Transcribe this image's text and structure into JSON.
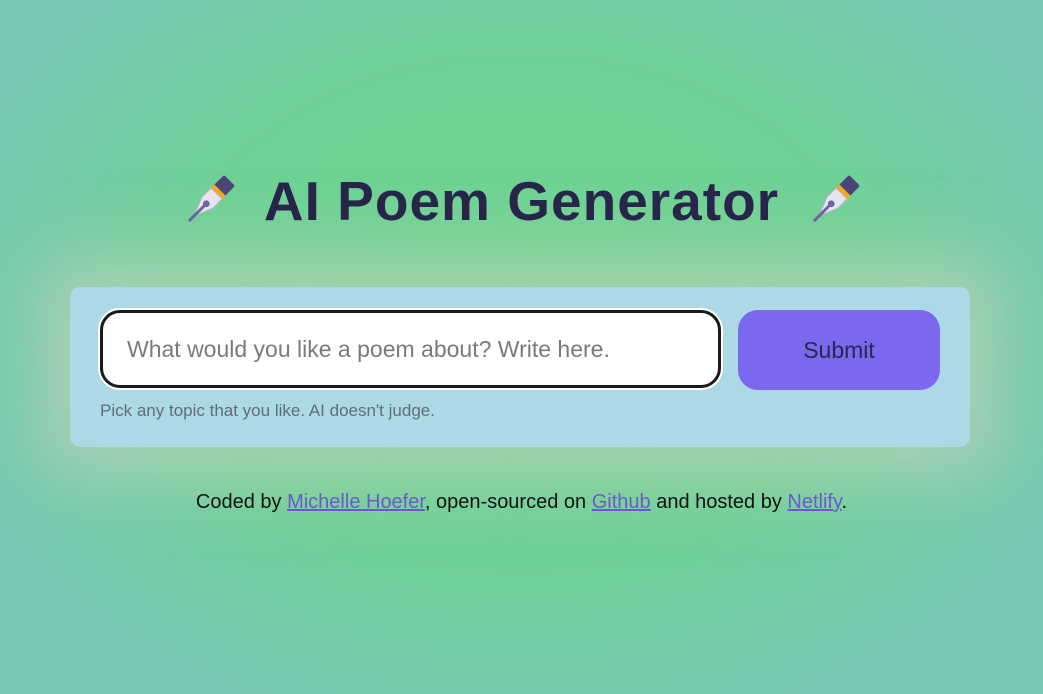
{
  "header": {
    "title": "AI Poem Generator",
    "left_icon": "fountain-pen-icon",
    "right_icon": "fountain-pen-icon"
  },
  "form": {
    "input_placeholder": "What would you like a poem about? Write here.",
    "input_value": "",
    "submit_label": "Submit",
    "hint": "Pick any topic that you like. AI doesn't judge."
  },
  "footer": {
    "prefix": "Coded by ",
    "author_link": "Michelle Hoefer",
    "middle": ", open-sourced on ",
    "github_link": "Github",
    "connector": " and hosted by ",
    "netlify_link": "Netlify",
    "suffix": "."
  },
  "colors": {
    "title": "#27264a",
    "card": "#add8e6",
    "button": "#7b68ee",
    "link": "#6a5acd",
    "background": "#6ed490"
  }
}
